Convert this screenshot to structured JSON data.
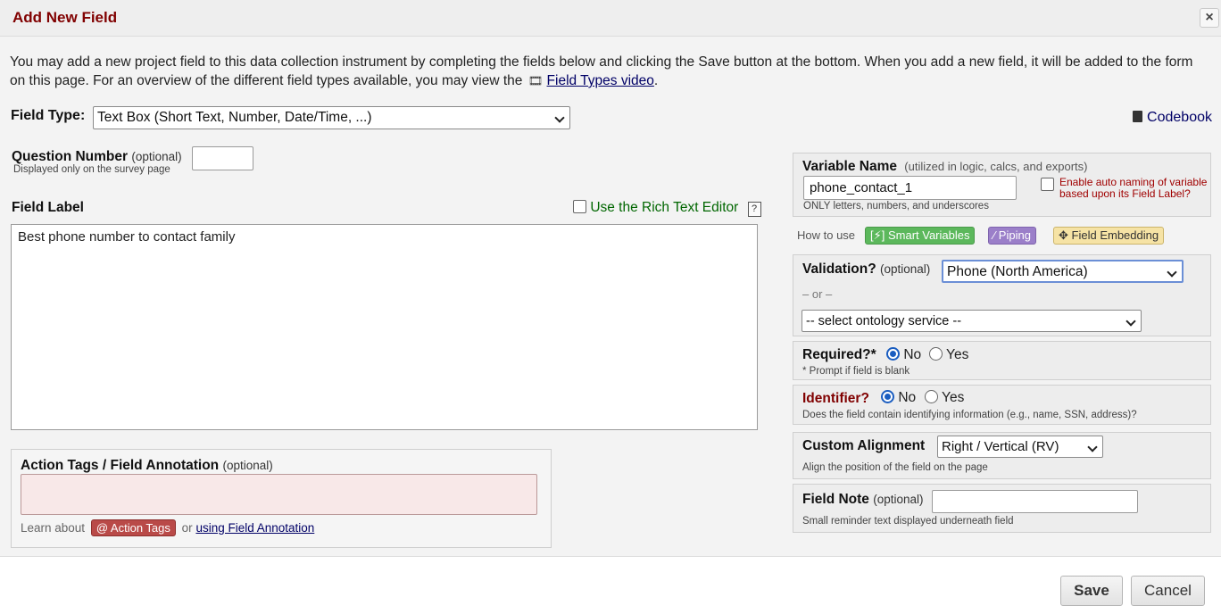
{
  "dialog": {
    "title": "Add New Field",
    "close_label": "×"
  },
  "intro": {
    "text_before": "You may add a new project field to this data collection instrument by completing the fields below and clicking the Save button at the bottom. When you add a new field, it will be added to the form on this page. For an overview of the different field types available, you may view the",
    "link": "Field Types video",
    "text_after": "."
  },
  "field_type": {
    "label": "Field Type:",
    "value": "Text Box (Short Text, Number, Date/Time, ...)"
  },
  "codebook": {
    "label": "Codebook"
  },
  "question_number": {
    "label": "Question Number",
    "optional": "(optional)",
    "sub": "Displayed only on the survey page",
    "value": ""
  },
  "field_label": {
    "label": "Field Label",
    "rich_text_label": "Use the Rich Text Editor",
    "help": "?",
    "value": "Best phone number to contact family"
  },
  "action_tags": {
    "label": "Action Tags / Field Annotation",
    "optional": "(optional)",
    "learn_about": "Learn about",
    "badge": "@ Action Tags",
    "or": "or",
    "link": "using Field Annotation",
    "value": ""
  },
  "variable_name": {
    "label": "Variable Name",
    "hint": "(utilized in logic, calcs, and exports)",
    "value": "phone_contact_1",
    "sub": "ONLY letters, numbers, and underscores",
    "auto_naming": "Enable auto naming of variable based upon its Field Label?"
  },
  "how_to_use": {
    "label": "How to use",
    "smart_variables": "[⚡] Smart Variables",
    "piping": "Piping",
    "embedding": "Field Embedding"
  },
  "validation": {
    "label": "Validation?",
    "optional": "(optional)",
    "value": "Phone (North America)",
    "or": "– or –",
    "ontology": "-- select ontology service --"
  },
  "required": {
    "label": "Required?*",
    "no": "No",
    "yes": "Yes",
    "sub": "* Prompt if field is blank",
    "selected": "No"
  },
  "identifier": {
    "label": "Identifier?",
    "no": "No",
    "yes": "Yes",
    "sub": "Does the field contain identifying information (e.g., name, SSN, address)?",
    "selected": "No"
  },
  "alignment": {
    "label": "Custom Alignment",
    "value": "Right / Vertical (RV)",
    "sub": "Align the position of the field on the page"
  },
  "field_note": {
    "label": "Field Note",
    "optional": "(optional)",
    "sub": "Small reminder text displayed underneath field",
    "value": ""
  },
  "footer": {
    "save": "Save",
    "cancel": "Cancel"
  },
  "colors": {
    "title": "#800000",
    "link": "#000066",
    "rich_text": "#006600",
    "identifier": "#800000",
    "action_tag_badge": "#b94a48"
  }
}
